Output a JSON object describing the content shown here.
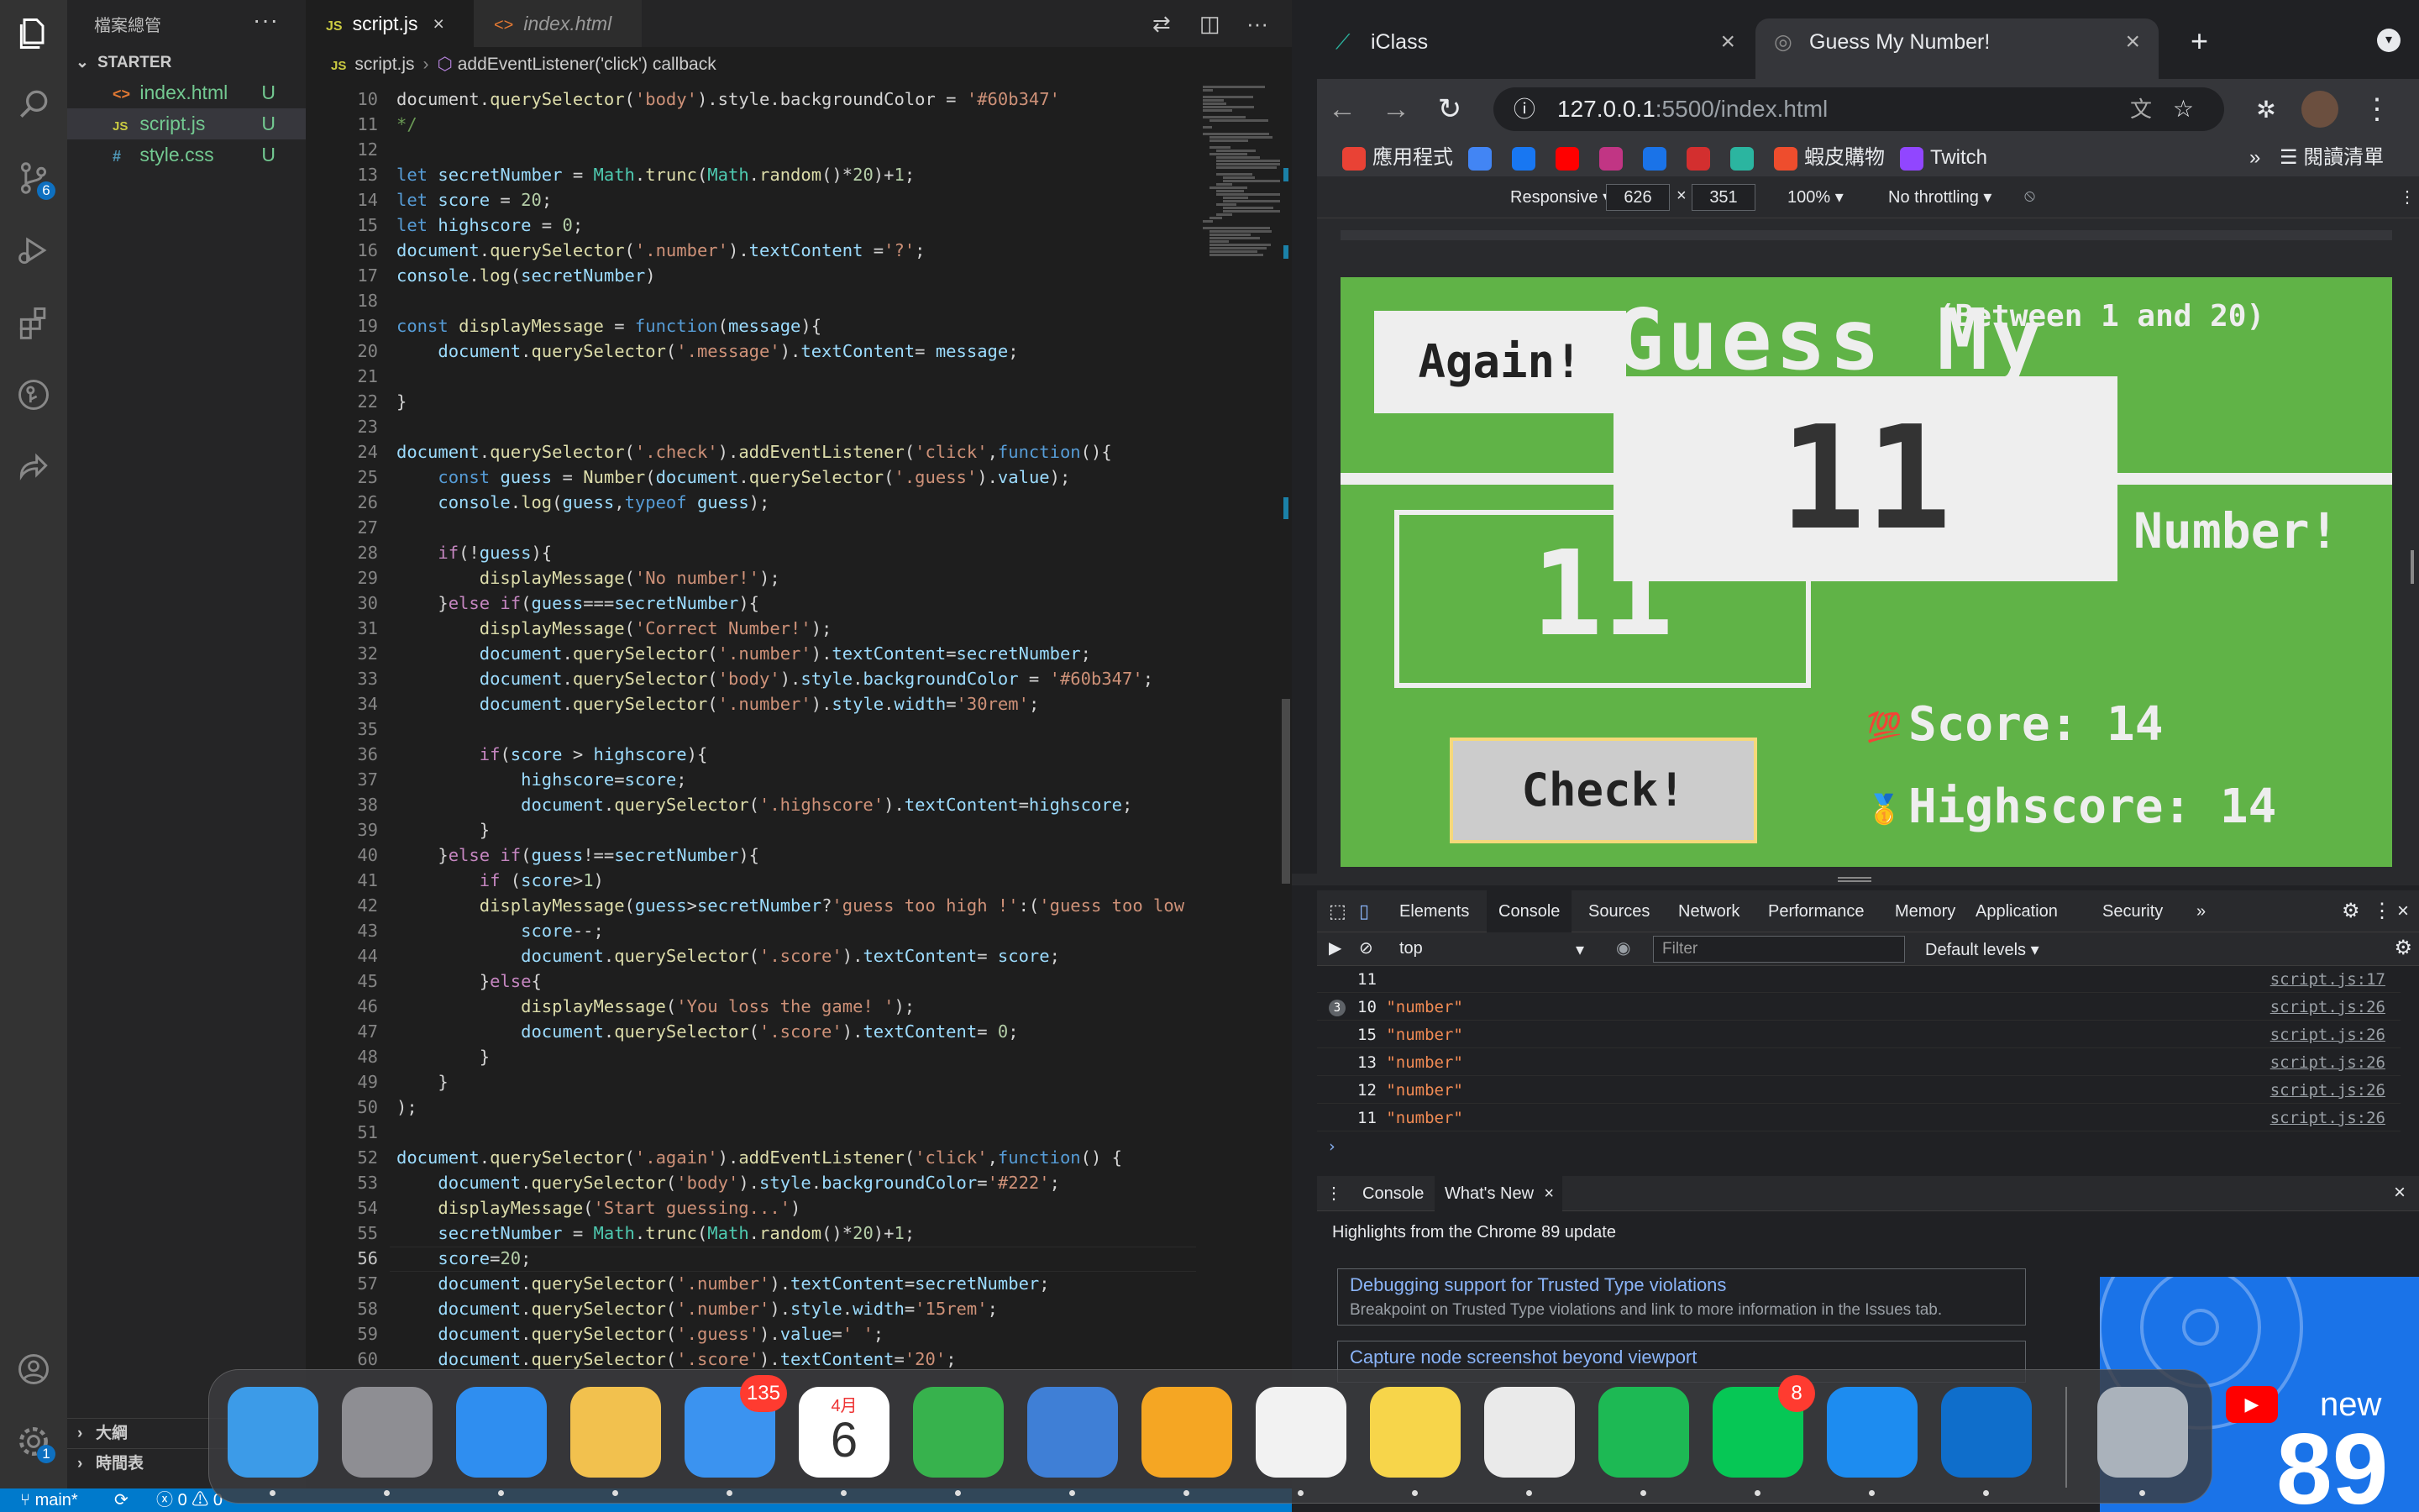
{
  "vscode": {
    "explorer_title": "檔案總管",
    "section": "STARTER",
    "files": [
      {
        "name": "index.html",
        "icon": "<>",
        "status": "U"
      },
      {
        "name": "script.js",
        "icon": "JS",
        "status": "U"
      },
      {
        "name": "style.css",
        "icon": "#",
        "status": "U"
      }
    ],
    "outline_label": "大綱",
    "timeline_label": "時間表",
    "scm_badge": "6",
    "settings_badge": "1",
    "tabs": [
      {
        "label": "script.js",
        "icon": "JS"
      },
      {
        "label": "index.html",
        "icon": "<>"
      }
    ],
    "breadcrumb": {
      "file": "script.js",
      "symbol": "addEventListener('click') callback"
    },
    "status": {
      "branch": "main*",
      "errors": "0",
      "warnings": "0"
    }
  },
  "code_lines": [
    {
      "n": "10",
      "html": "<span class=\"o\">document.</span><span class=\"f\">querySelector</span><span class=\"o\">(</span><span class=\"s\">'body'</span><span class=\"o\">).style.backgroundColor = </span><span class=\"s\">'#60b347'</span>"
    },
    {
      "n": "11",
      "html": "<span class=\"c\">*/</span>"
    },
    {
      "n": "12",
      "html": ""
    },
    {
      "n": "13",
      "html": "<span class=\"k\">let</span> <span class=\"v\">secretNumber</span> = <span class=\"t\">Math</span>.<span class=\"f\">trunc</span>(<span class=\"t\">Math</span>.<span class=\"f\">random</span>()*<span class=\"n\">20</span>)+<span class=\"n\">1</span>;"
    },
    {
      "n": "14",
      "html": "<span class=\"k\">let</span> <span class=\"v\">score</span> = <span class=\"n\">20</span>;"
    },
    {
      "n": "15",
      "html": "<span class=\"k\">let</span> <span class=\"v\">highscore</span> = <span class=\"n\">0</span>;"
    },
    {
      "n": "16",
      "html": "<span class=\"v\">document</span>.<span class=\"f\">querySelector</span>(<span class=\"s\">'.number'</span>).<span class=\"v\">textContent</span> =<span class=\"s\">'?'</span>;"
    },
    {
      "n": "17",
      "html": "<span class=\"v\">console</span>.<span class=\"f\">log</span>(<span class=\"v\">secretNumber</span>)"
    },
    {
      "n": "18",
      "html": ""
    },
    {
      "n": "19",
      "html": "<span class=\"k\">const</span> <span class=\"f\">displayMessage</span> = <span class=\"k\">function</span>(<span class=\"v\">message</span>){"
    },
    {
      "n": "20",
      "html": "    <span class=\"v\">document</span>.<span class=\"f\">querySelector</span>(<span class=\"s\">'.message'</span>).<span class=\"v\">textContent</span>= <span class=\"v\">message</span>;"
    },
    {
      "n": "21",
      "html": ""
    },
    {
      "n": "22",
      "html": "}"
    },
    {
      "n": "23",
      "html": ""
    },
    {
      "n": "24",
      "html": "<span class=\"v\">document</span>.<span class=\"f\">querySelector</span>(<span class=\"s\">'.check'</span>).<span class=\"f\">addEventListener</span>(<span class=\"s\">'click'</span>,<span class=\"k\">function</span>(){"
    },
    {
      "n": "25",
      "html": "    <span class=\"k\">const</span> <span class=\"v\">guess</span> = <span class=\"f\">Number</span>(<span class=\"v\">document</span>.<span class=\"f\">querySelector</span>(<span class=\"s\">'.guess'</span>).<span class=\"v\">value</span>);"
    },
    {
      "n": "26",
      "html": "    <span class=\"v\">console</span>.<span class=\"f\">log</span>(<span class=\"v\">guess</span>,<span class=\"k\">typeof</span> <span class=\"v\">guess</span>);"
    },
    {
      "n": "27",
      "html": ""
    },
    {
      "n": "28",
      "html": "    <span class=\"ck\">if</span>(!<span class=\"v\">guess</span>){"
    },
    {
      "n": "29",
      "html": "        <span class=\"f\">displayMessage</span>(<span class=\"s\">'No number!'</span>);"
    },
    {
      "n": "30",
      "html": "    }<span class=\"ck\">else if</span>(<span class=\"v\">guess</span>===<span class=\"v\">secretNumber</span>){"
    },
    {
      "n": "31",
      "html": "        <span class=\"f\">displayMessage</span>(<span class=\"s\">'Correct Number!'</span>);"
    },
    {
      "n": "32",
      "html": "        <span class=\"v\">document</span>.<span class=\"f\">querySelector</span>(<span class=\"s\">'.number'</span>).<span class=\"v\">textContent</span>=<span class=\"v\">secretNumber</span>;"
    },
    {
      "n": "33",
      "html": "        <span class=\"v\">document</span>.<span class=\"f\">querySelector</span>(<span class=\"s\">'body'</span>).<span class=\"v\">style</span>.<span class=\"v\">backgroundColor</span> = <span class=\"s\">'#60b347'</span>;"
    },
    {
      "n": "34",
      "html": "        <span class=\"v\">document</span>.<span class=\"f\">querySelector</span>(<span class=\"s\">'.number'</span>).<span class=\"v\">style</span>.<span class=\"v\">width</span>=<span class=\"s\">'30rem'</span>;"
    },
    {
      "n": "35",
      "html": ""
    },
    {
      "n": "36",
      "html": "        <span class=\"ck\">if</span>(<span class=\"v\">score</span> &gt; <span class=\"v\">highscore</span>){"
    },
    {
      "n": "37",
      "html": "            <span class=\"v\">highscore</span>=<span class=\"v\">score</span>;"
    },
    {
      "n": "38",
      "html": "            <span class=\"v\">document</span>.<span class=\"f\">querySelector</span>(<span class=\"s\">'.highscore'</span>).<span class=\"v\">textContent</span>=<span class=\"v\">highscore</span>;"
    },
    {
      "n": "39",
      "html": "        }"
    },
    {
      "n": "40",
      "html": "    }<span class=\"ck\">else if</span>(<span class=\"v\">guess</span>!==<span class=\"v\">secretNumber</span>){"
    },
    {
      "n": "41",
      "html": "        <span class=\"ck\">if</span> (<span class=\"v\">score</span>&gt;<span class=\"n\">1</span>)"
    },
    {
      "n": "42",
      "html": "        <span class=\"f\">displayMessage</span>(<span class=\"v\">guess</span>&gt;<span class=\"v\">secretNumber</span>?<span class=\"s\">'guess too high !'</span>:(<span class=\"s\">'guess too low !'</span>"
    },
    {
      "n": "43",
      "html": "            <span class=\"v\">score</span>--;"
    },
    {
      "n": "44",
      "html": "            <span class=\"v\">document</span>.<span class=\"f\">querySelector</span>(<span class=\"s\">'.score'</span>).<span class=\"v\">textContent</span>= <span class=\"v\">score</span>;"
    },
    {
      "n": "45",
      "html": "        }<span class=\"ck\">else</span>{"
    },
    {
      "n": "46",
      "html": "            <span class=\"f\">displayMessage</span>(<span class=\"s\">'You loss the game! '</span>);"
    },
    {
      "n": "47",
      "html": "            <span class=\"v\">document</span>.<span class=\"f\">querySelector</span>(<span class=\"s\">'.score'</span>).<span class=\"v\">textContent</span>= <span class=\"n\">0</span>;"
    },
    {
      "n": "48",
      "html": "        }"
    },
    {
      "n": "49",
      "html": "    }"
    },
    {
      "n": "50",
      "html": ");"
    },
    {
      "n": "51",
      "html": ""
    },
    {
      "n": "52",
      "html": "<span class=\"v\">document</span>.<span class=\"f\">querySelector</span>(<span class=\"s\">'.again'</span>).<span class=\"f\">addEventListener</span>(<span class=\"s\">'click'</span>,<span class=\"k\">function</span>() {"
    },
    {
      "n": "53",
      "html": "    <span class=\"v\">document</span>.<span class=\"f\">querySelector</span>(<span class=\"s\">'body'</span>).<span class=\"v\">style</span>.<span class=\"v\">backgroundColor</span>=<span class=\"s\">'#222'</span>;"
    },
    {
      "n": "54",
      "html": "    <span class=\"f\">displayMessage</span>(<span class=\"s\">'Start guessing...'</span>)"
    },
    {
      "n": "55",
      "html": "    <span class=\"v\">secretNumber</span> = <span class=\"t\">Math</span>.<span class=\"f\">trunc</span>(<span class=\"t\">Math</span>.<span class=\"f\">random</span>()*<span class=\"n\">20</span>)+<span class=\"n\">1</span>;"
    },
    {
      "n": "56",
      "html": "    <span class=\"v\">score</span>=<span class=\"n\">20</span>;"
    },
    {
      "n": "57",
      "html": "    <span class=\"v\">document</span>.<span class=\"f\">querySelector</span>(<span class=\"s\">'.number'</span>).<span class=\"v\">textContent</span>=<span class=\"v\">secretNumber</span>;"
    },
    {
      "n": "58",
      "html": "    <span class=\"v\">document</span>.<span class=\"f\">querySelector</span>(<span class=\"s\">'.number'</span>).<span class=\"v\">style</span>.<span class=\"v\">width</span>=<span class=\"s\">'15rem'</span>;"
    },
    {
      "n": "59",
      "html": "    <span class=\"v\">document</span>.<span class=\"f\">querySelector</span>(<span class=\"s\">'.guess'</span>).<span class=\"v\">value</span>=<span class=\"s\">' '</span>;"
    },
    {
      "n": "60",
      "html": "    <span class=\"v\">document</span>.<span class=\"f\">querySelector</span>(<span class=\"s\">'.score'</span>).<span class=\"v\">textContent</span>=<span class=\"s\">'20'</span>;"
    }
  ],
  "current_line": "56",
  "chrome": {
    "tabs": [
      {
        "label": "iClass"
      },
      {
        "label": "Guess My Number!"
      }
    ],
    "url_host": "127.0.0.1",
    "url_rest": ":5500/index.html",
    "bookmarks": [
      {
        "label": "應用程式",
        "color": "#e94235"
      },
      {
        "label": "",
        "color": "#4285f4"
      },
      {
        "label": "",
        "color": "#1877f2"
      },
      {
        "label": "",
        "color": "#ff0000"
      },
      {
        "label": "",
        "color": "#c13584"
      },
      {
        "label": "",
        "color": "#1a73e8"
      },
      {
        "label": "",
        "color": "#d32f2f"
      },
      {
        "label": "",
        "color": "#2bb5a0"
      },
      {
        "label": "蝦皮購物",
        "color": "#ee4d2d"
      },
      {
        "label": "Twitch",
        "color": "#9146ff"
      }
    ],
    "reading_list": "閱讀清單",
    "device": {
      "mode": "Responsive",
      "width": "626",
      "height": "351",
      "zoom": "100%",
      "throttle": "No throttling"
    }
  },
  "game": {
    "again": "Again!",
    "between": "(Between 1 and 20)",
    "title_top": "Guess My",
    "title_bottom": "Number!",
    "number": "11",
    "guess": "11",
    "check": "Check!",
    "score_label": "Score:",
    "score": "14",
    "highscore_label": "Highscore:",
    "highscore": "14",
    "bg_color": "#60b347"
  },
  "devtools": {
    "tabs": [
      "Elements",
      "Console",
      "Sources",
      "Network",
      "Performance",
      "Memory",
      "Application",
      "Security"
    ],
    "context": "top",
    "filter_placeholder": "Filter",
    "levels": "Default levels",
    "logs": [
      {
        "count": "",
        "value": "11",
        "type": "",
        "src": "script.js:17"
      },
      {
        "count": "3",
        "value": "10",
        "type": "\"number\"",
        "src": "script.js:26"
      },
      {
        "count": "",
        "value": "15",
        "type": "\"number\"",
        "src": "script.js:26"
      },
      {
        "count": "",
        "value": "13",
        "type": "\"number\"",
        "src": "script.js:26"
      },
      {
        "count": "",
        "value": "12",
        "type": "\"number\"",
        "src": "script.js:26"
      },
      {
        "count": "",
        "value": "11",
        "type": "\"number\"",
        "src": "script.js:26"
      }
    ],
    "drawer_tabs": [
      "Console",
      "What's New"
    ],
    "whats_new_title": "Highlights from the Chrome 89 update",
    "items": [
      {
        "heading": "Debugging support for Trusted Type violations",
        "desc": "Breakpoint on Trusted Type violations and link to more information in the Issues tab."
      },
      {
        "heading": "Capture node screenshot beyond viewport",
        "desc": ""
      }
    ],
    "promo_text": "new",
    "promo_number": "89"
  },
  "dock": {
    "apps": [
      {
        "name": "finder",
        "color": "#3c9be8",
        "badge": ""
      },
      {
        "name": "system-preferences",
        "color": "#8e8e93",
        "badge": ""
      },
      {
        "name": "safari",
        "color": "#2f8ef0",
        "badge": ""
      },
      {
        "name": "photos",
        "color": "#f2c14e",
        "badge": ""
      },
      {
        "name": "mail",
        "color": "#3b93f0",
        "badge": "135"
      },
      {
        "name": "calendar",
        "color": "#ffffff",
        "badge": ""
      },
      {
        "name": "numbers",
        "color": "#37b24d",
        "badge": ""
      },
      {
        "name": "keynote",
        "color": "#3f7fd6",
        "badge": ""
      },
      {
        "name": "pages",
        "color": "#f5a623",
        "badge": ""
      },
      {
        "name": "reminders",
        "color": "#f2f2f2",
        "badge": ""
      },
      {
        "name": "notes",
        "color": "#f7d54a",
        "badge": ""
      },
      {
        "name": "chrome",
        "color": "#eaeaea",
        "badge": ""
      },
      {
        "name": "spotify",
        "color": "#1db954",
        "badge": ""
      },
      {
        "name": "line",
        "color": "#06c755",
        "badge": "8"
      },
      {
        "name": "xcode",
        "color": "#1d8cf0",
        "badge": ""
      },
      {
        "name": "vscode",
        "color": "#0f6ecb",
        "badge": ""
      },
      {
        "name": "trash",
        "color": "#aab2bb",
        "badge": ""
      }
    ],
    "calendar_month": "4月",
    "calendar_day": "6"
  }
}
